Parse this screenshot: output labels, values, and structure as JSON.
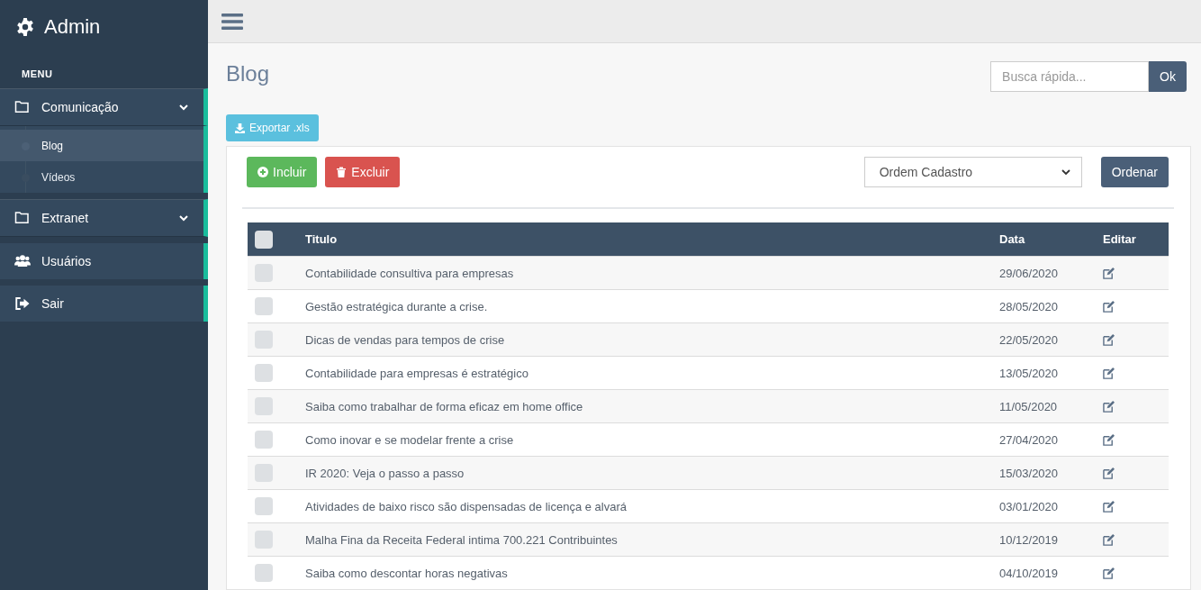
{
  "brand": {
    "title": "Admin"
  },
  "sidebar": {
    "heading": "MENU",
    "items": [
      {
        "label": "Comunicação",
        "kind": "group",
        "children": [
          {
            "label": "Blog",
            "selected": true
          },
          {
            "label": "Vídeos",
            "selected": false
          }
        ]
      },
      {
        "label": "Extranet",
        "kind": "group"
      },
      {
        "label": "Usuários",
        "kind": "users"
      },
      {
        "label": "Sair",
        "kind": "exit"
      }
    ]
  },
  "page": {
    "title": "Blog"
  },
  "search": {
    "placeholder": "Busca rápida...",
    "button": "Ok"
  },
  "export_button": "Exportar .xls",
  "toolbar": {
    "add_button": "Incluir",
    "delete_button": "Excluir",
    "sort_select": "Ordem Cadastro",
    "sort_button": "Ordenar"
  },
  "table": {
    "columns": [
      "Titulo",
      "Data",
      "Editar"
    ],
    "header_checked": false,
    "rows": [
      {
        "title": "Contabilidade consultiva para empresas",
        "date": "29/06/2020",
        "checked": false
      },
      {
        "title": "Gestão estratégica durante a crise.",
        "date": "28/05/2020",
        "checked": false
      },
      {
        "title": "Dicas de vendas para tempos de crise",
        "date": "22/05/2020",
        "checked": false
      },
      {
        "title": "Contabilidade para empresas é estratégico",
        "date": "13/05/2020",
        "checked": false
      },
      {
        "title": "Saiba como trabalhar de forma eficaz em home office",
        "date": "11/05/2020",
        "checked": false
      },
      {
        "title": "Como inovar e se modelar frente a crise",
        "date": "27/04/2020",
        "checked": false
      },
      {
        "title": "IR 2020: Veja o passo a passo",
        "date": "15/03/2020",
        "checked": false
      },
      {
        "title": "Atividades de baixo risco são dispensadas de licença e alvará",
        "date": "03/01/2020",
        "checked": false
      },
      {
        "title": "Malha Fina da Receita Federal intima 700.221 Contribuintes",
        "date": "10/12/2019",
        "checked": false
      },
      {
        "title": "Saiba como descontar horas negativas",
        "date": "04/10/2019",
        "checked": false
      }
    ]
  }
}
